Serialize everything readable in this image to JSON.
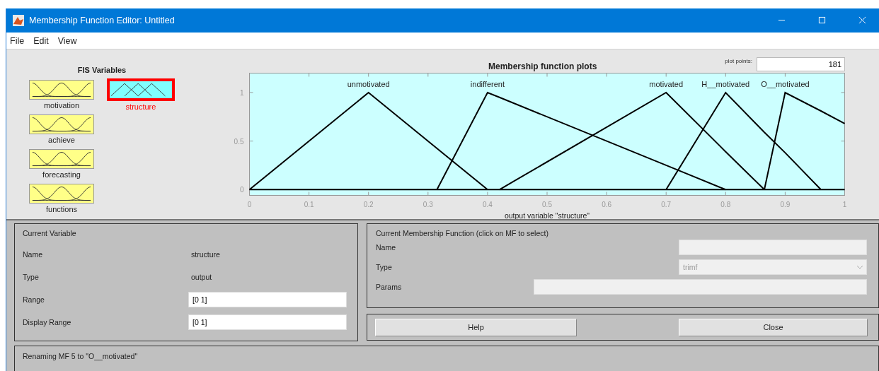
{
  "window": {
    "title": "Membership Function Editor: Untitled"
  },
  "menu": [
    "File",
    "Edit",
    "View"
  ],
  "fis_variables": {
    "title": "FIS Variables",
    "items": [
      {
        "name": "motivation",
        "kind": "input",
        "selected": false
      },
      {
        "name": "achieve",
        "kind": "input",
        "selected": false
      },
      {
        "name": "forecasting",
        "kind": "input",
        "selected": false
      },
      {
        "name": "functions",
        "kind": "input",
        "selected": false
      },
      {
        "name": "structure",
        "kind": "output",
        "selected": true
      }
    ]
  },
  "plot": {
    "plot_points_label": "plot points:",
    "plot_points": "181",
    "chart_data": {
      "type": "line",
      "title": "Membership function plots",
      "xlabel": "output variable \"structure\"",
      "x": [
        0,
        0.2,
        0.315,
        0.4,
        0.42,
        0.7,
        0.8,
        0.865,
        0.9,
        0.96,
        1
      ],
      "series": [
        {
          "name": "unmotivated",
          "color": "#000000",
          "values": [
            0,
            1,
            0.425,
            0,
            null,
            null,
            null,
            null,
            null,
            null,
            null
          ]
        },
        {
          "name": "indifferent",
          "color": "#000000",
          "values": [
            null,
            null,
            0,
            1,
            0.95,
            0.25,
            0,
            null,
            null,
            null,
            null
          ]
        },
        {
          "name": "motivated",
          "color": "#000000",
          "values": [
            null,
            null,
            null,
            null,
            0,
            1,
            0.39,
            0,
            null,
            null,
            null
          ]
        },
        {
          "name": "H__motivated",
          "color": "#000000",
          "values": [
            null,
            null,
            null,
            null,
            null,
            0,
            1,
            0.59,
            0.38,
            0,
            null
          ]
        },
        {
          "name": "O__motivated",
          "color": "#000000",
          "values": [
            null,
            null,
            null,
            null,
            null,
            null,
            null,
            0,
            1,
            0.81,
            0.68
          ]
        }
      ],
      "xlim": [
        0,
        1
      ],
      "ylim": [
        -0.06,
        1.2
      ],
      "xticks": [
        0,
        0.1,
        0.2,
        0.3,
        0.4,
        0.5,
        0.6,
        0.7,
        0.8,
        0.9,
        1
      ],
      "yticks": [
        0,
        0.5,
        1
      ]
    }
  },
  "current_variable": {
    "title": "Current Variable",
    "name_label": "Name",
    "name": "structure",
    "type_label": "Type",
    "type": "output",
    "range_label": "Range",
    "range": "[0 1]",
    "display_range_label": "Display Range",
    "display_range": "[0 1]"
  },
  "current_mf": {
    "title": "Current Membership Function (click on MF to select)",
    "name_label": "Name",
    "type_label": "Type",
    "type": "trimf",
    "params_label": "Params",
    "disabled": true
  },
  "buttons": [
    "Help",
    "Close"
  ],
  "status": "Renaming MF 5 to \"O__motivated\""
}
